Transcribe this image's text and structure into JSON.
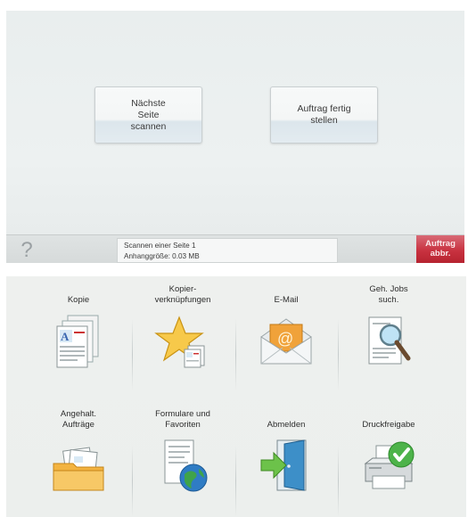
{
  "scan_dialog": {
    "next_page_button": "Nächste\nSeite\nscannen",
    "finish_job_button": "Auftrag fertig\nstellen",
    "help_glyph": "?",
    "status_line1": "Scannen einer Seite 1",
    "status_line2": "Anhanggröße: 0.03 MB",
    "cancel_job": "Auftrag\nabbr.",
    "cancel_color": "#c8313f"
  },
  "home_menu": {
    "row1": [
      {
        "label": "Kopie",
        "icon": "copy-icon"
      },
      {
        "label": "Kopier-\nverknüpfungen",
        "icon": "copy-shortcuts-icon"
      },
      {
        "label": "E-Mail",
        "icon": "email-icon"
      },
      {
        "label": "Geh. Jobs\nsuch.",
        "icon": "search-held-jobs-icon"
      }
    ],
    "row2": [
      {
        "label": "Angehalt.\nAufträge",
        "icon": "held-jobs-icon"
      },
      {
        "label": "Formulare und\nFavoriten",
        "icon": "forms-favorites-icon"
      },
      {
        "label": "Abmelden",
        "icon": "logout-icon"
      },
      {
        "label": "Druckfreigabe",
        "icon": "print-release-icon"
      }
    ]
  }
}
